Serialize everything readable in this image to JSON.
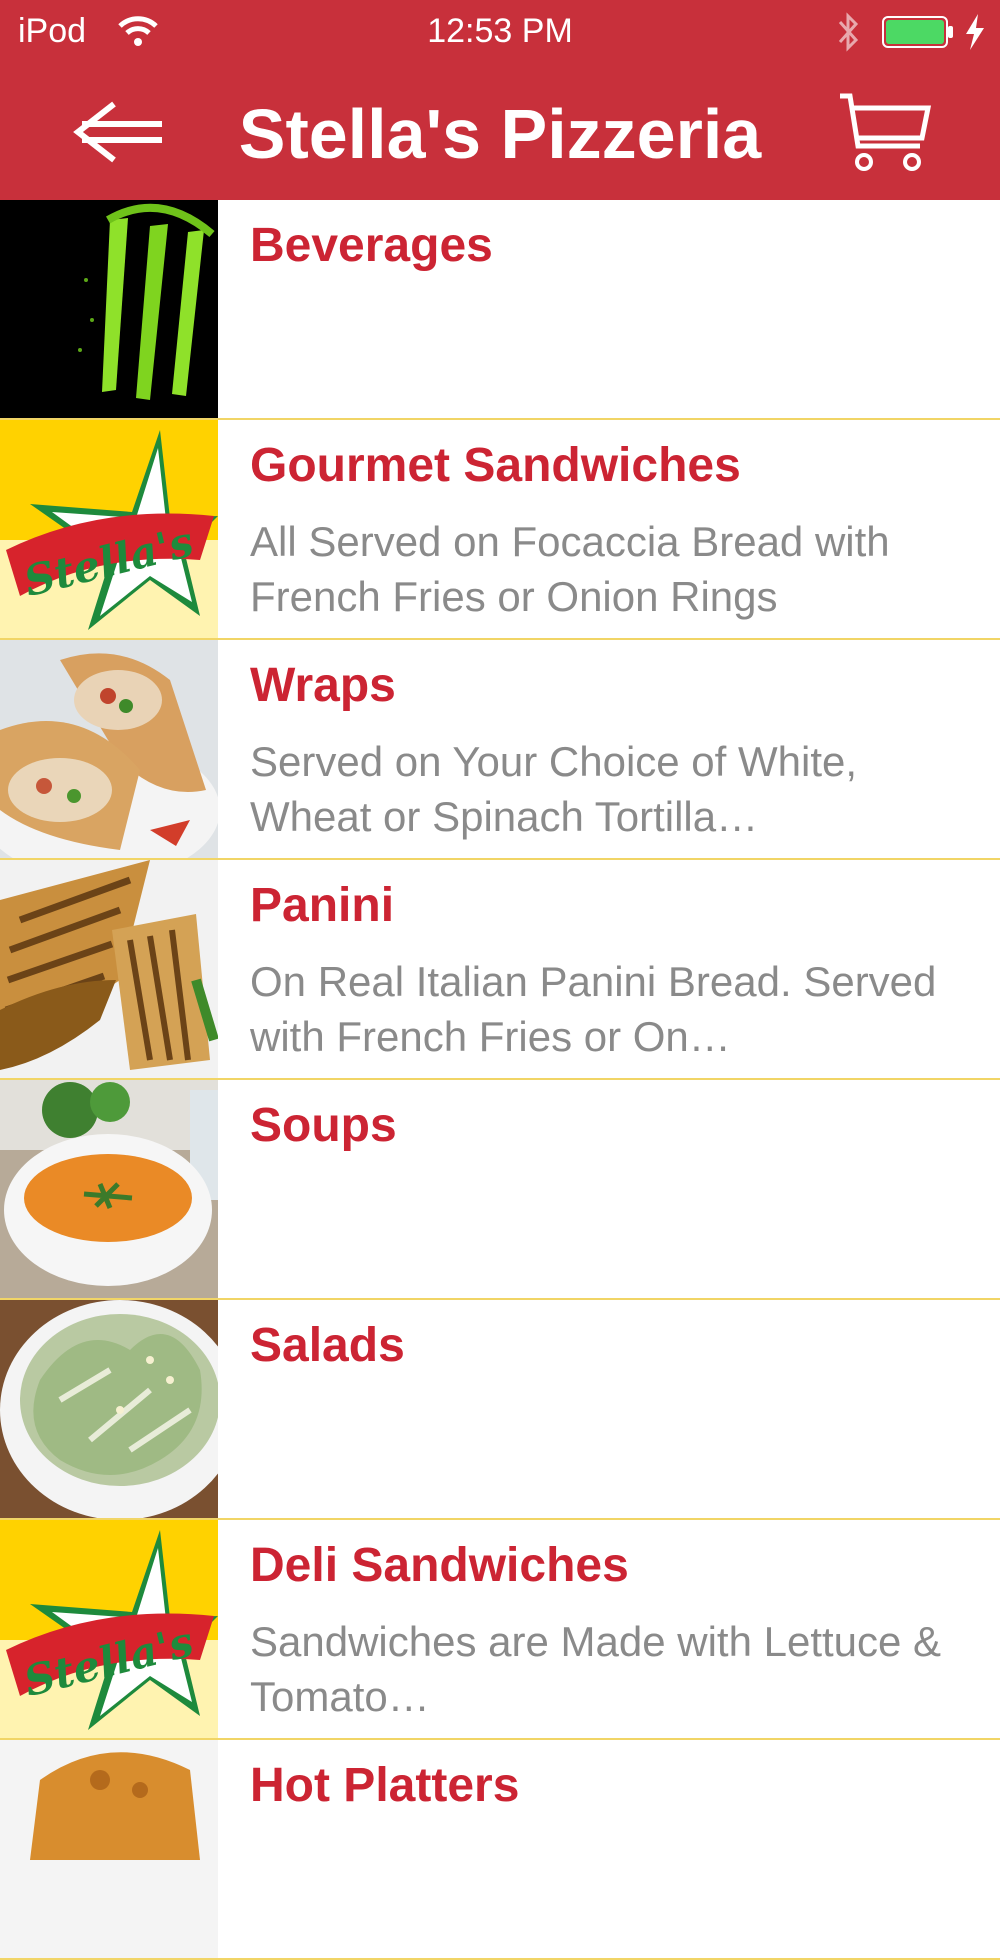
{
  "status_bar": {
    "carrier": "iPod",
    "time": "12:53 PM"
  },
  "nav": {
    "title": "Stella's Pizzeria",
    "back_icon": "back-arrow-icon",
    "cart_icon": "shopping-cart-icon"
  },
  "colors": {
    "header": "#c8303b",
    "row_title": "#cc2433",
    "row_description": "#8a8a8a",
    "divider": "#f1d566"
  },
  "categories": [
    {
      "title": "Beverages",
      "description": "",
      "image": "monster-energy-logo"
    },
    {
      "title": "Gourmet Sandwiches",
      "description": "All Served on Focaccia Bread with French Fries or Onion Rings",
      "image": "stellas-logo"
    },
    {
      "title": "Wraps",
      "description": "Served on Your Choice of White, Wheat or Spinach Tortilla…",
      "image": "wraps-photo"
    },
    {
      "title": "Panini",
      "description": "On Real Italian Panini Bread. Served with French Fries or On…",
      "image": "panini-photo"
    },
    {
      "title": "Soups",
      "description": "",
      "image": "soup-photo"
    },
    {
      "title": "Salads",
      "description": "",
      "image": "salad-photo"
    },
    {
      "title": "Deli Sandwiches",
      "description": "Sandwiches are Made with Lettuce & Tomato…",
      "image": "stellas-logo"
    },
    {
      "title": "Hot Platters",
      "description": "",
      "image": "platter-photo"
    }
  ]
}
